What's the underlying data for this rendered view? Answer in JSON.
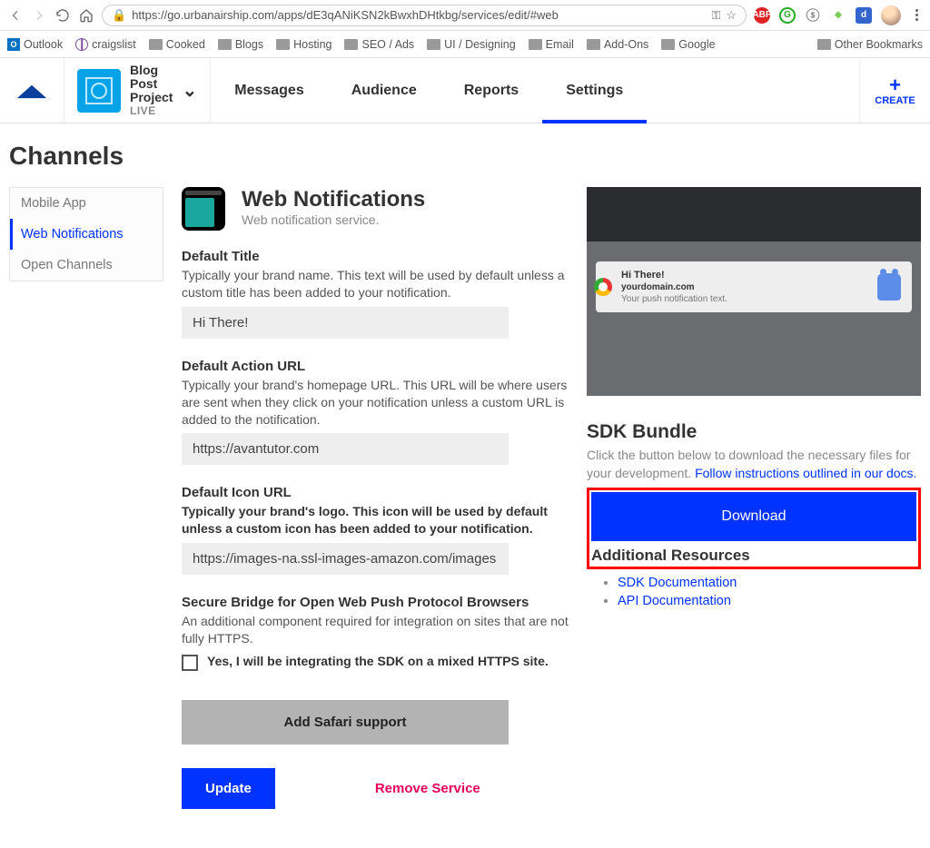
{
  "browser": {
    "url": "https://go.urbanairship.com/apps/dE3qANiKSN2kBwxhDHtkbg/services/edit/#web",
    "bookmarks": [
      "Outlook",
      "craigslist",
      "Cooked",
      "Blogs",
      "Hosting",
      "SEO / Ads",
      "UI / Designing",
      "Email",
      "Add-Ons",
      "Google",
      "Other Bookmarks"
    ]
  },
  "header": {
    "project_line1": "Blog",
    "project_line2": "Post",
    "project_line3": "Project",
    "project_status": "LIVE",
    "tabs": [
      "Messages",
      "Audience",
      "Reports",
      "Settings"
    ],
    "create": "CREATE"
  },
  "page_title": "Channels",
  "sidebar": {
    "items": [
      "Mobile App",
      "Web Notifications",
      "Open Channels"
    ]
  },
  "section": {
    "title": "Web Notifications",
    "subtitle": "Web notification service."
  },
  "fields": {
    "default_title": {
      "label": "Default Title",
      "help": "Typically your brand name. This text will be used by default unless a custom title has been added to your notification.",
      "value": "Hi There!"
    },
    "default_action_url": {
      "label": "Default Action URL",
      "help": "Typically your brand's homepage URL. This URL will be where users are sent when they click on your notification unless a custom URL is added to the notification.",
      "value": "https://avantutor.com"
    },
    "default_icon_url": {
      "label": "Default Icon URL",
      "help": "Typically your brand's logo. This icon will be used by default unless a custom icon has been added to your notification.",
      "value": "https://images-na.ssl-images-amazon.com/images"
    },
    "secure_bridge": {
      "label": "Secure Bridge for Open Web Push Protocol Browsers",
      "help": "An additional component required for integration on sites that are not fully HTTPS.",
      "checkbox_label": "Yes, I will be integrating the SDK on a mixed HTTPS site."
    }
  },
  "buttons": {
    "safari": "Add Safari support",
    "update": "Update",
    "remove": "Remove Service",
    "download": "Download"
  },
  "preview": {
    "title": "Hi There!",
    "domain": "yourdomain.com",
    "body": "Your push notification text."
  },
  "sdk": {
    "title": "SDK Bundle",
    "help_prefix": "Click the button below to download the necessary files for your development. ",
    "help_link": "Follow instructions outlined in our docs."
  },
  "resources": {
    "title": "Additional Resources",
    "links": [
      "SDK Documentation",
      "API Documentation"
    ]
  }
}
